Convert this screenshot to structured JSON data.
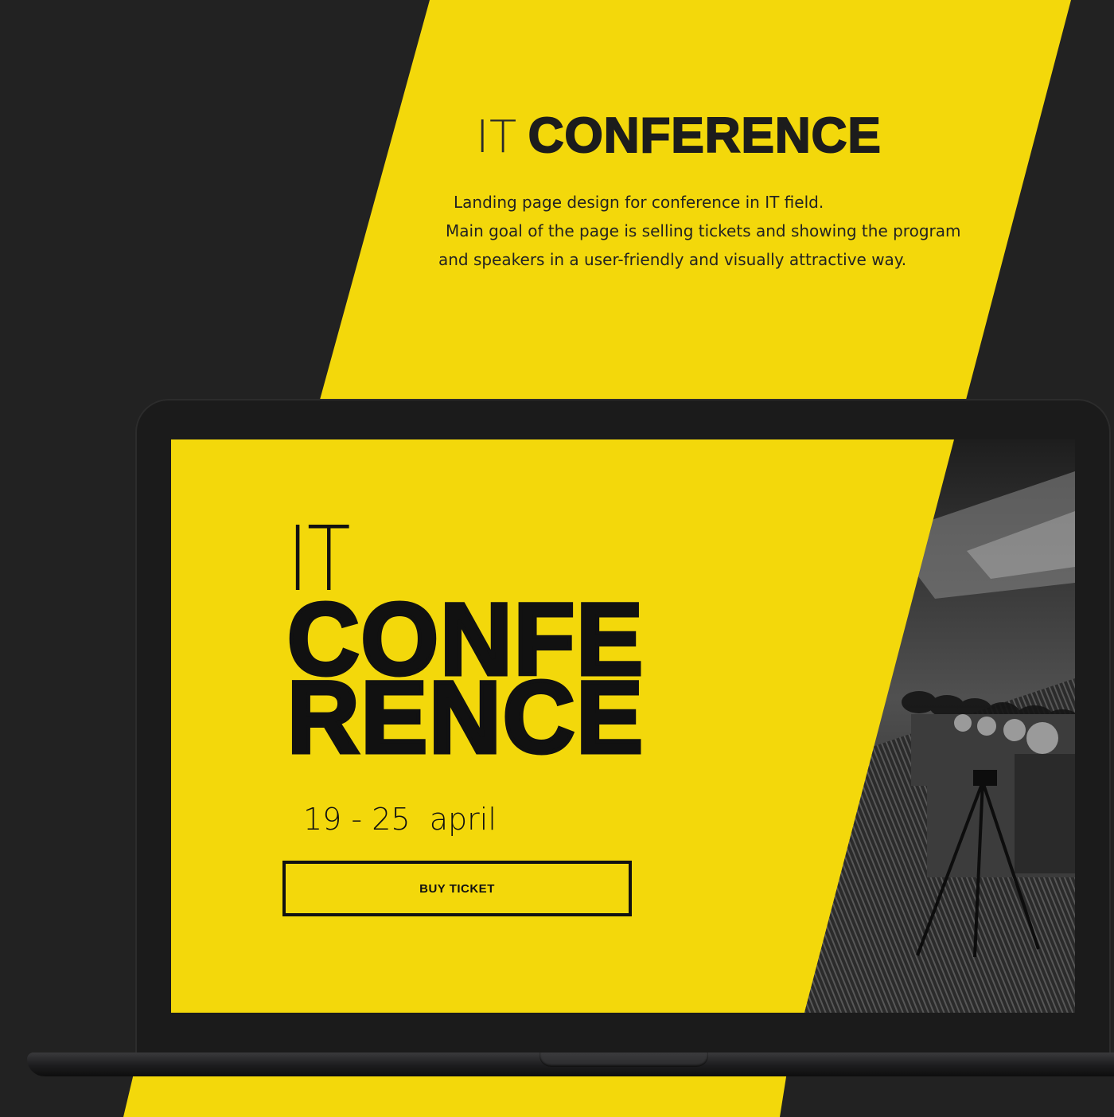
{
  "colors": {
    "background": "#222222",
    "accent_yellow": "#f3d80b",
    "text_dark": "#111111"
  },
  "intro": {
    "title_light": "IT",
    "title_bold": "CONFERENCE",
    "description_lines": [
      "Landing page design for conference in IT field.",
      "Main goal of the page is selling tickets and showing the program",
      "and speakers in a user-friendly and visually attractive way."
    ]
  },
  "landing": {
    "hero_light": "IT",
    "hero_bold_lines": [
      "CONFE",
      "RENCE"
    ],
    "date": "19 - 25  april",
    "cta_label": "BUY TICKET"
  }
}
